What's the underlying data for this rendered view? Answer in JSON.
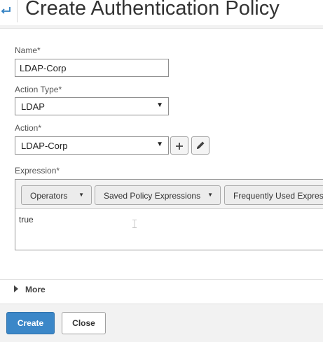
{
  "header": {
    "title": "Create Authentication Policy",
    "back_icon": "back-arrow-icon"
  },
  "form": {
    "name": {
      "label": "Name*",
      "value": "LDAP-Corp"
    },
    "action_type": {
      "label": "Action Type*",
      "value": "LDAP"
    },
    "action": {
      "label": "Action*",
      "value": "LDAP-Corp",
      "add_icon": "plus-icon",
      "edit_icon": "pencil-icon"
    },
    "expression": {
      "label": "Expression*",
      "toolbar": [
        {
          "label": "Operators"
        },
        {
          "label": "Saved Policy Expressions"
        },
        {
          "label": "Frequently Used Expressions"
        }
      ],
      "value": "true"
    },
    "more": {
      "label": "More"
    }
  },
  "footer": {
    "create_label": "Create",
    "close_label": "Close"
  },
  "colors": {
    "primary_button": "#3b87c8",
    "back_icon": "#2f7fc1"
  }
}
